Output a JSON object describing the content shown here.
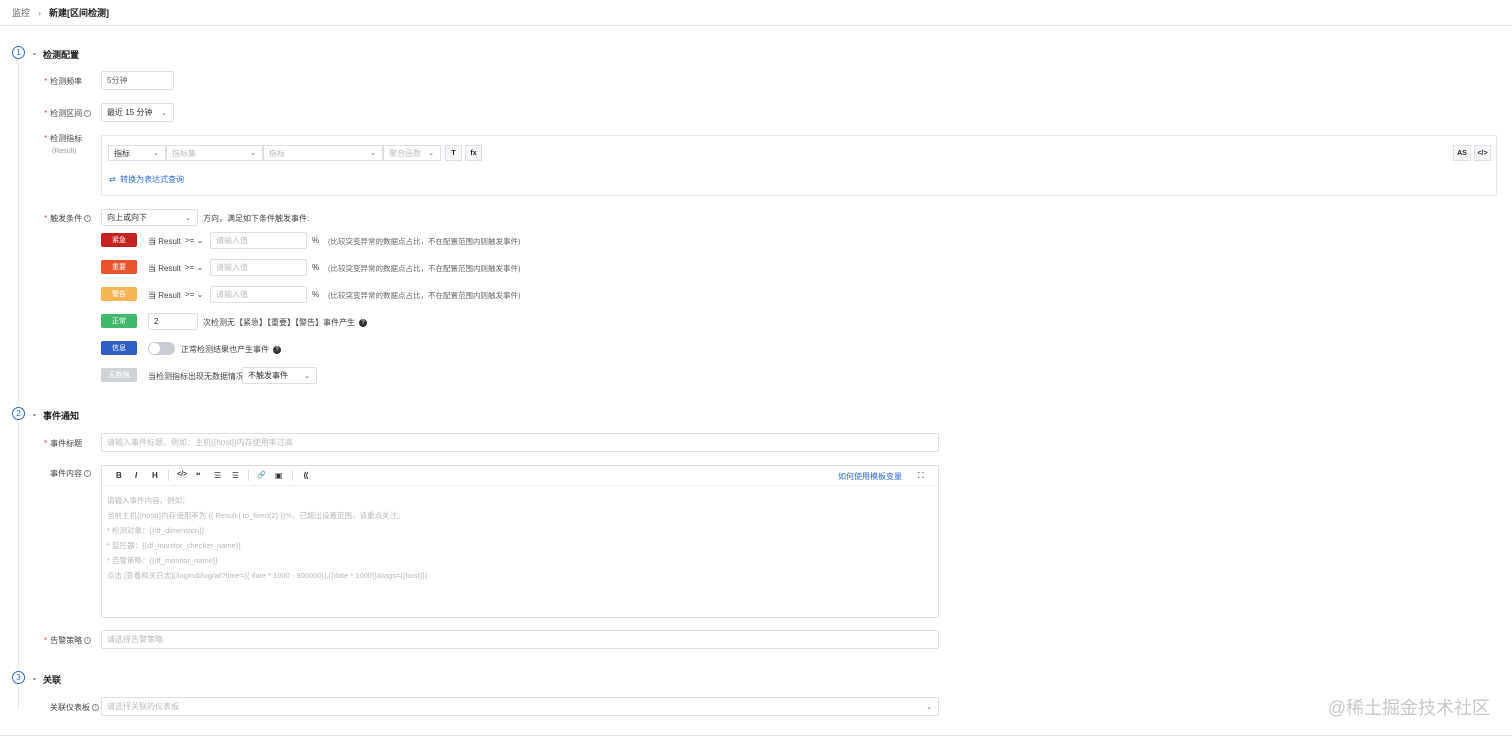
{
  "breadcrumb": {
    "parent": "监控",
    "current": "新建[区间检测]"
  },
  "steps": [
    {
      "num": "1",
      "title": "检测配置"
    },
    {
      "num": "2",
      "title": "事件通知"
    },
    {
      "num": "3",
      "title": "关联"
    }
  ],
  "detect": {
    "freq_label": "检测频率",
    "freq_value": "5分钟",
    "interval_label": "检测区间",
    "interval_value": "最近 15 分钟",
    "metric_label": "检测指标",
    "metric_sub": "(Result)",
    "metric_type": "指标",
    "metric_set_ph": "指标集",
    "metric_ph": "指标",
    "agg_ph": "聚合函数",
    "filter_btn": "T",
    "fx_btn": "fx",
    "as_btn": "AS",
    "code_btn": "</>",
    "convert_link": "转换为表达式查询",
    "trigger_label": "触发条件",
    "direction_value": "向上或向下",
    "direction_suffix": "方向，满足如下条件触发事件:"
  },
  "conditions": [
    {
      "level": "紧急",
      "color": "#c5221f",
      "subject": "当 Result",
      "op": ">=",
      "placeholder": "请输入值",
      "unit": "%",
      "note": "(比较突变异常的数据点占比，不在配置范围内则触发事件)"
    },
    {
      "level": "重要",
      "color": "#e8532a",
      "subject": "当 Result",
      "op": ">=",
      "placeholder": "请输入值",
      "unit": "%",
      "note": "(比较突变异常的数据点占比，不在配置范围内则触发事件)"
    },
    {
      "level": "警告",
      "color": "#f5b555",
      "subject": "当 Result",
      "op": ">=",
      "placeholder": "请输入值",
      "unit": "%",
      "note": "(比较突变异常的数据点占比，不在配置范围内则触发事件)"
    }
  ],
  "normal": {
    "level": "正常",
    "color": "#3fb96b",
    "count": "2",
    "text": "次检测无【紧急】【重要】【警告】事件产生"
  },
  "info": {
    "level": "信息",
    "color": "#2f5fc4",
    "text": "正常检测结果也产生事件"
  },
  "nodata": {
    "level": "无数据",
    "color": "#cfd2d6",
    "text": "当检测指标出现无数据情况",
    "value": "不触发事件"
  },
  "notify": {
    "title_label": "事件标题",
    "title_ph": "请输入事件标题，例如：主机{{host}}内存使用率过高",
    "content_label": "事件内容",
    "help_link": "如何使用模板变量",
    "toolbar": [
      "B",
      "I",
      "H",
      "</>",
      "❝",
      "☰",
      "☰",
      "🔗",
      "▣",
      "⟪"
    ],
    "body_lines": [
      "请输入事件内容，例如：",
      "当前主机{{host}}内存使用率为 {{ Result | to_fixed(2) }}%，已超出设置范围，请重点关注。",
      "* 检测对象：{{df_dimension}}",
      "* 监控器：{{df_monitor_checker_name}}",
      "* 告警策略：{{df_monitor_name}}",
      "点击 [查看相关日志](/logIndi/log/all?time={{ date * 1000 - 900000}},{{date * 1000}}&tags={{host}})"
    ],
    "policy_label": "告警策略",
    "policy_ph": "请选择告警策略"
  },
  "relate": {
    "dashboard_label": "关联仪表板",
    "dashboard_ph": "请选择关联的仪表板"
  },
  "watermark": "@稀土掘金技术社区"
}
